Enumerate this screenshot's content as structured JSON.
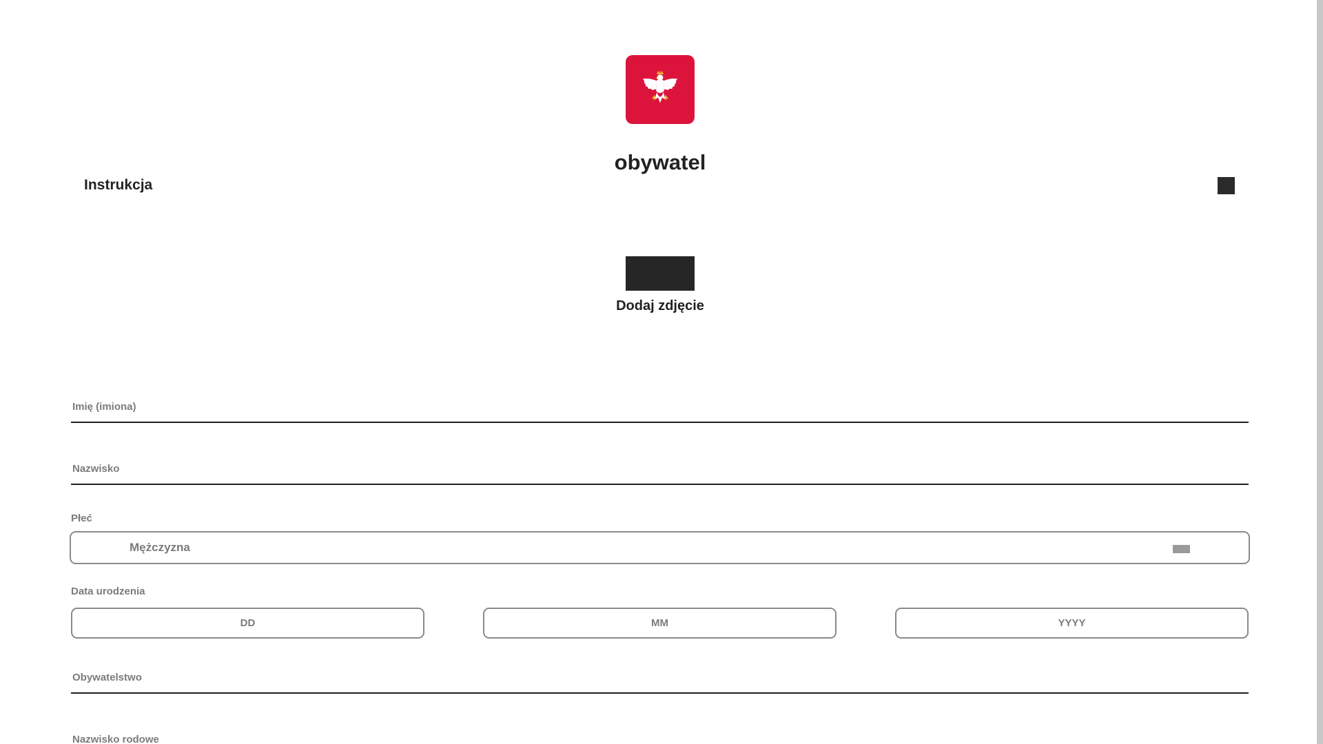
{
  "app": {
    "title": "obywatel"
  },
  "colors": {
    "brand": "#dc143c",
    "text": "#222222",
    "muted": "#7b7b7b"
  },
  "logo": {
    "icon": "white-eagle-emblem"
  },
  "instructions": {
    "label": "Instrukcja",
    "toggle_icon": "square-toggle-icon"
  },
  "photo": {
    "label": "Dodaj zdjęcie"
  },
  "form": {
    "first_name": {
      "label": "Imię (imiona)",
      "value": ""
    },
    "last_name": {
      "label": "Nazwisko",
      "value": ""
    },
    "gender": {
      "label": "Płeć",
      "value": "Mężczyzna",
      "icon": "chevron-down-icon"
    },
    "birth_date": {
      "label": "Data urodzenia",
      "day_placeholder": "DD",
      "month_placeholder": "MM",
      "year_placeholder": "YYYY"
    },
    "citizenship": {
      "label": "Obywatelstwo",
      "value": ""
    },
    "maiden_name": {
      "label": "Nazwisko rodowe",
      "value": ""
    }
  }
}
